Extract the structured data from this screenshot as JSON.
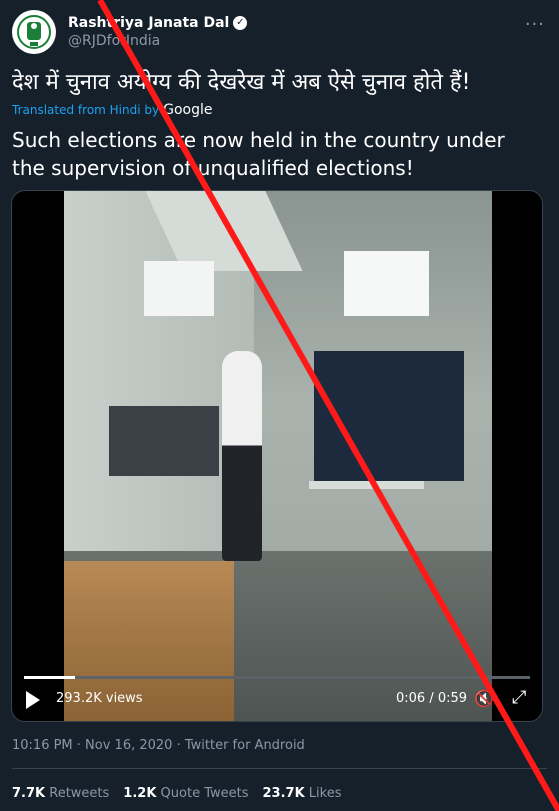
{
  "account": {
    "display_name": "Rashtriya Janata Dal",
    "handle": "@RJDforIndia"
  },
  "icons": [
    "avatar-logo",
    "verified-badge-icon",
    "more-options-icon",
    "play-icon",
    "mute-icon",
    "fullscreen-icon"
  ],
  "tweet": {
    "hindi_text": "देश में चुनाव अयोग्य की देखरेख में अब ऐसे चुनाव होते हैं!",
    "translated_label": "Translated from Hindi by",
    "translator": "Google",
    "english_text": "Such elections are now held in the country under the supervision of unqualified elections!"
  },
  "video": {
    "views": "293.2K views",
    "time": "0:06 / 0:59",
    "progress_fraction": 0.1
  },
  "meta": {
    "line": "10:16 PM · Nov 16, 2020 · Twitter for Android"
  },
  "stats": {
    "retweets_count": "7.7K",
    "retweets_label": "Retweets",
    "quotes_count": "1.2K",
    "quotes_label": "Quote Tweets",
    "likes_count": "23.7K",
    "likes_label": "Likes"
  },
  "colors": {
    "background": "#15202b",
    "accent": "#1da1f2",
    "secondary_text": "#8899a6",
    "overlay_cross": "#ff1a1a"
  }
}
